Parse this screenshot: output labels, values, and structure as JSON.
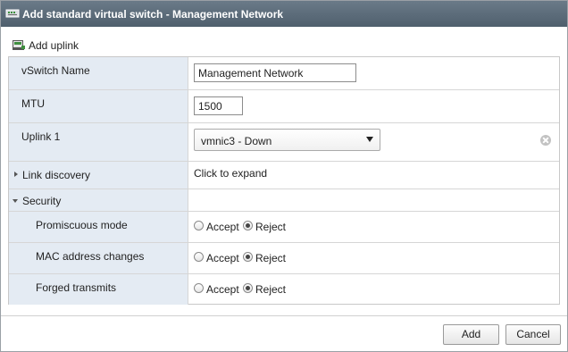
{
  "dialog": {
    "title": "Add standard virtual switch - Management Network"
  },
  "toolbar": {
    "add_uplink_label": "Add uplink"
  },
  "form": {
    "vswitch_name": {
      "label": "vSwitch Name",
      "value": "Management Network"
    },
    "mtu": {
      "label": "MTU",
      "value": "1500"
    },
    "uplink1": {
      "label": "Uplink 1",
      "selected": "vmnic3 - Down"
    },
    "link_discovery": {
      "label": "Link discovery",
      "value": "Click to expand"
    },
    "security": {
      "label": "Security",
      "promiscuous_mode": {
        "label": "Promiscuous mode",
        "accept": "Accept",
        "reject": "Reject",
        "selected": "Reject"
      },
      "mac_address_changes": {
        "label": "MAC address changes",
        "accept": "Accept",
        "reject": "Reject",
        "selected": "Reject"
      },
      "forged_transmits": {
        "label": "Forged transmits",
        "accept": "Accept",
        "reject": "Reject",
        "selected": "Reject"
      }
    }
  },
  "footer": {
    "add_label": "Add",
    "cancel_label": "Cancel"
  },
  "colors": {
    "titlebar": "#5a6a78",
    "label_column": "#e4ebf3"
  }
}
